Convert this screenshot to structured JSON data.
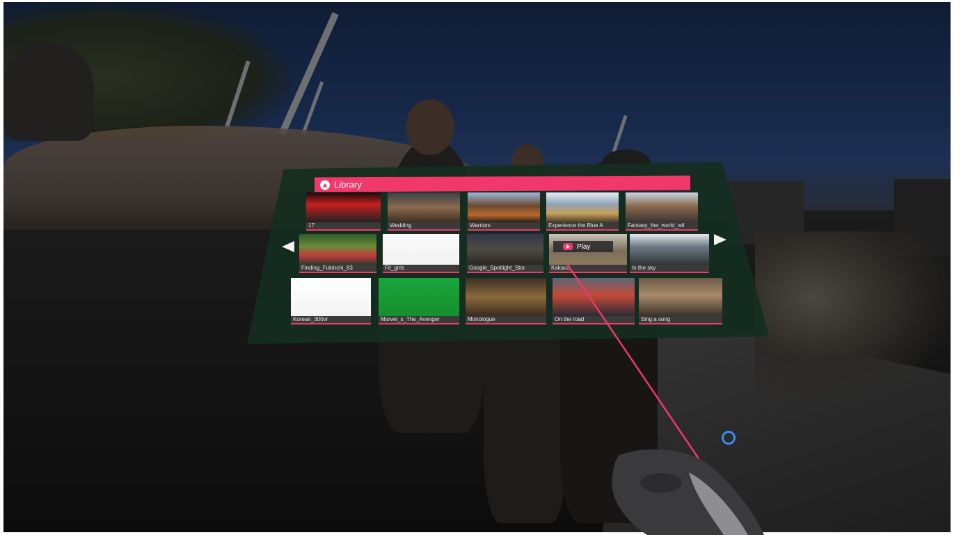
{
  "panel": {
    "title": "Library",
    "play_label": "Play",
    "videos": [
      {
        "title": "17"
      },
      {
        "title": "Wedding"
      },
      {
        "title": "Warriors"
      },
      {
        "title": "Experience the Blue A"
      },
      {
        "title": "Fantasy_the_world_wil"
      },
      {
        "title": "Finding_Fukinchi_83"
      },
      {
        "title": "Fit_girls"
      },
      {
        "title": "Google_Spotlight_Stor"
      },
      {
        "title": "Kakao3"
      },
      {
        "title": "In the sky"
      },
      {
        "title": "Korean_300vr"
      },
      {
        "title": "Marvel_s_The_Avenger"
      },
      {
        "title": "Monologue"
      },
      {
        "title": "On the road"
      },
      {
        "title": "Sing a song"
      }
    ]
  },
  "colors": {
    "accent": "#f0386a",
    "panel_bg": "#142d20",
    "cursor": "#3d8bf0"
  },
  "icons": {
    "library": "library-icon",
    "prev": "arrow-left-icon",
    "next": "arrow-right-icon",
    "play": "play-icon",
    "cursor": "ring-cursor-icon"
  }
}
